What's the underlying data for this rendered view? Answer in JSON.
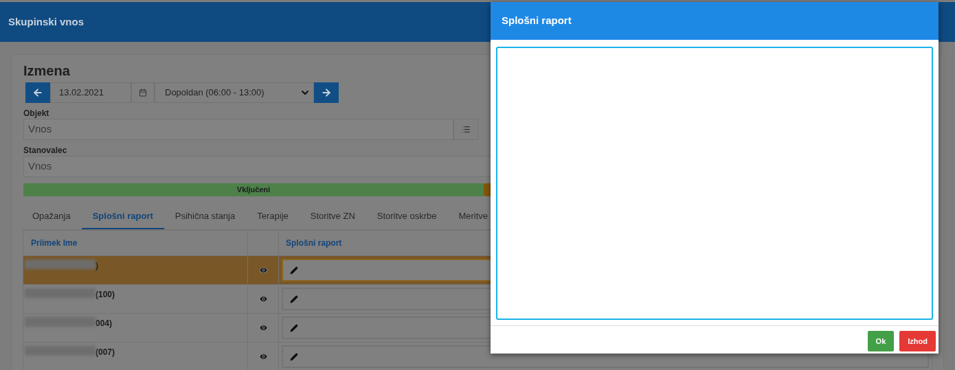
{
  "header": {
    "title": "Skupinski vnos"
  },
  "card": {
    "title": "Izmena",
    "date": "13.02.2021",
    "shift": "Dopoldan (06:00 - 13:00)",
    "fields": [
      {
        "label": "Objekt",
        "placeholder": "Vnos",
        "kind": "list"
      },
      {
        "label": "Stanovalec",
        "placeholder": "Vnos",
        "kind": "plain"
      }
    ],
    "status_bar": {
      "label": "Vključeni"
    }
  },
  "tabs": [
    {
      "label": "Opažanja",
      "selected": false
    },
    {
      "label": "Splošni raport",
      "selected": true
    },
    {
      "label": "Psihična stanja",
      "selected": false
    },
    {
      "label": "Terapije",
      "selected": false
    },
    {
      "label": "Storitve ZN",
      "selected": false
    },
    {
      "label": "Storitve oskrbe",
      "selected": false
    },
    {
      "label": "Meritve",
      "selected": false
    }
  ],
  "table": {
    "columns": [
      "Priimek Ime",
      "Splošni raport"
    ],
    "rows": [
      {
        "name_visible": ")",
        "selected": true
      },
      {
        "name_visible": "(100)",
        "selected": false
      },
      {
        "name_visible": "004)",
        "selected": false
      },
      {
        "name_visible": "(007)",
        "selected": false
      }
    ]
  },
  "dialog": {
    "title": "Splošni raport",
    "buttons": [
      {
        "label": "Ok",
        "kind": "ok"
      },
      {
        "label": "Izhod",
        "kind": "exit"
      }
    ]
  }
}
